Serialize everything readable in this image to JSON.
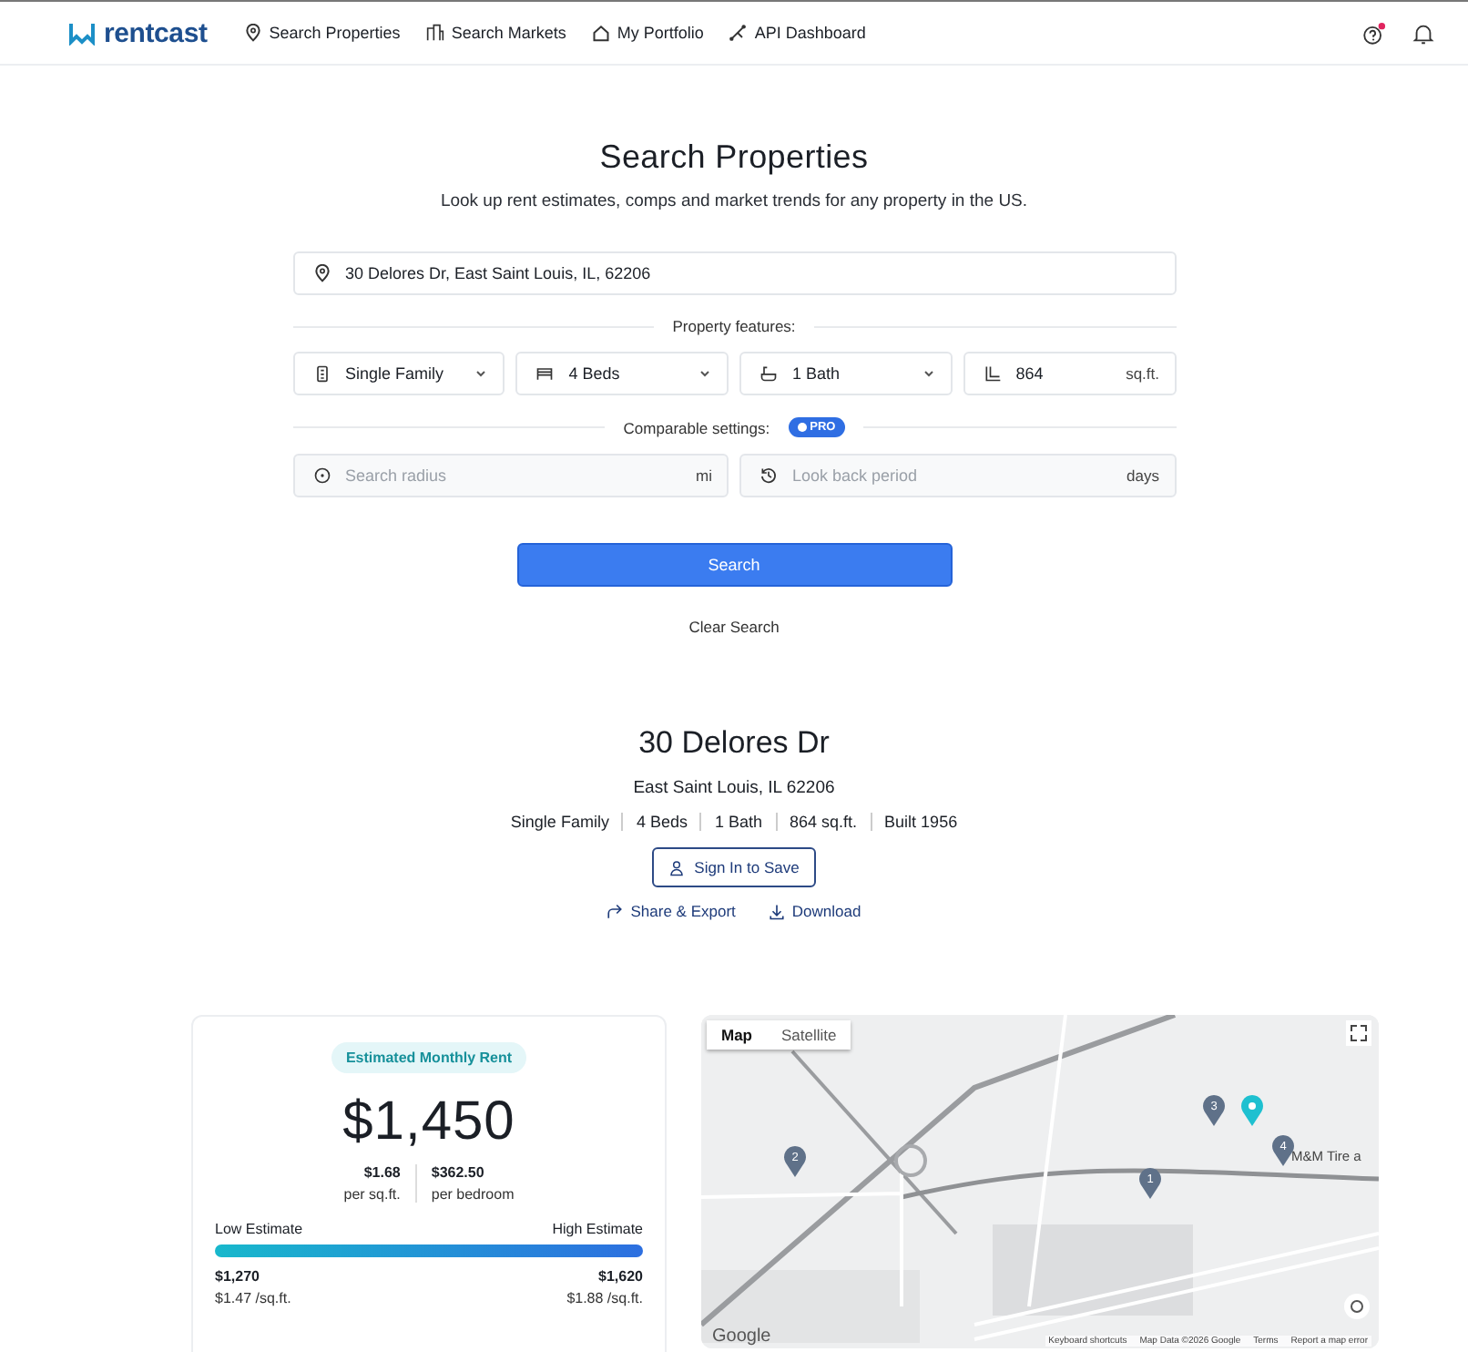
{
  "nav": {
    "brand": "rentcast",
    "items": [
      {
        "label": "Search Properties"
      },
      {
        "label": "Search Markets"
      },
      {
        "label": "My Portfolio"
      },
      {
        "label": "API Dashboard"
      }
    ]
  },
  "search": {
    "title": "Search Properties",
    "subtitle": "Look up rent estimates, comps and market trends for any property in the US.",
    "address": "30 Delores Dr, East Saint Louis, IL, 62206",
    "features_label": "Property features:",
    "features": [
      {
        "kind": "select",
        "value": "Single Family"
      },
      {
        "kind": "select",
        "value": "4 Beds"
      },
      {
        "kind": "select",
        "value": "1 Bath"
      },
      {
        "kind": "input",
        "value": "864",
        "unit": "sq.ft."
      }
    ],
    "comparable_label": "Comparable settings:",
    "badge": "PRO",
    "settings": [
      {
        "placeholder": "Search radius",
        "unit": "mi"
      },
      {
        "placeholder": "Look back period",
        "unit": "days"
      }
    ],
    "search_button": "Search",
    "clear_button": "Clear Search"
  },
  "property": {
    "title": "30 Delores Dr",
    "city": "East Saint Louis, IL 62206",
    "specs": [
      "Single Family",
      "4 Beds",
      "1 Bath",
      "864 sq.ft.",
      "Built 1956"
    ],
    "save_button": "Sign In to Save",
    "actions": [
      {
        "kind": "share",
        "label": "Share & Export"
      },
      {
        "kind": "download",
        "label": "Download"
      }
    ]
  },
  "estimate": {
    "label": "Estimated Monthly Rent",
    "value": "$1,450",
    "stats": [
      {
        "value": "$1.68",
        "label": "per sq.ft."
      },
      {
        "value": "$362.50",
        "label": "per bedroom"
      }
    ],
    "low": {
      "label": "Low Estimate",
      "value": "$1,270",
      "per": "$1.47 /sq.ft."
    },
    "high": {
      "label": "High Estimate",
      "value": "$1,620",
      "per": "$1.88 /sq.ft."
    }
  },
  "map": {
    "tabs": [
      {
        "label": "Map",
        "selected": true
      },
      {
        "label": "Satellite",
        "selected": false
      }
    ],
    "pins": [
      {
        "kind": "subject"
      },
      {
        "kind": "comp",
        "label": "1"
      },
      {
        "kind": "comp",
        "label": "2"
      },
      {
        "kind": "comp",
        "label": "3"
      },
      {
        "kind": "comp",
        "label": "4"
      }
    ],
    "place_label": "M&M Tire a",
    "logo": "Google",
    "footer": [
      "Keyboard shortcuts",
      "Map Data ©2026 Google",
      "Terms",
      "Report a map error"
    ]
  }
}
